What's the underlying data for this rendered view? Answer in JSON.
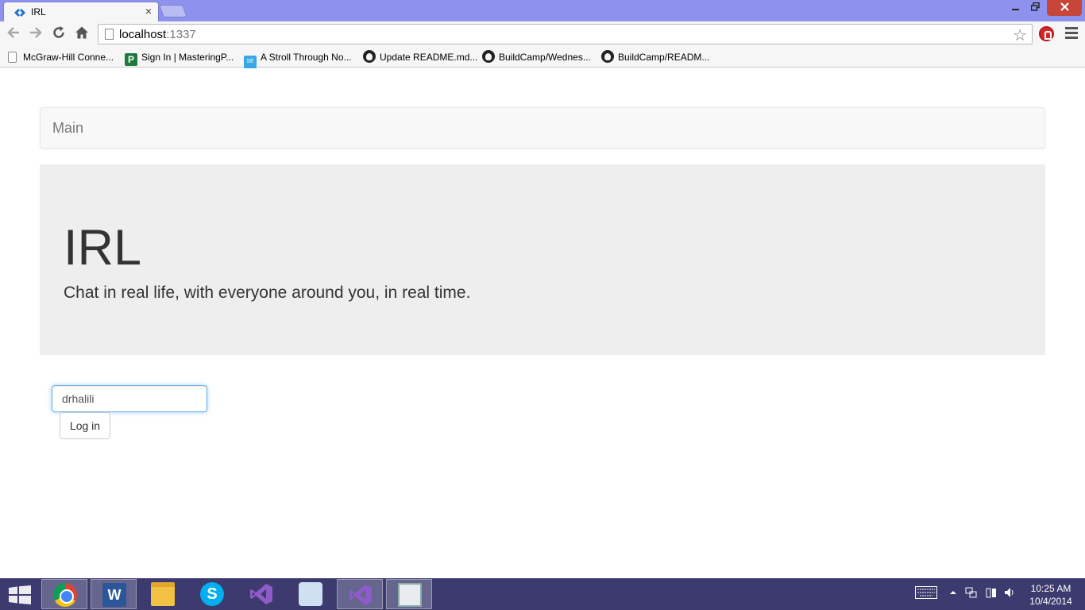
{
  "browser": {
    "tab_title": "IRL",
    "tab_close": "×",
    "address": {
      "host": "localhost",
      "port": ":1337"
    },
    "bookmarks": [
      {
        "label": "McGraw-Hill Conne...",
        "icon": "page-icon"
      },
      {
        "label": "Sign In | MasteringP...",
        "icon": "pearson-icon"
      },
      {
        "label": "A Stroll Through No...",
        "icon": "stackexchange-icon"
      },
      {
        "label": "Update README.md...",
        "icon": "github-icon"
      },
      {
        "label": "BuildCamp/Wednes...",
        "icon": "github-icon"
      },
      {
        "label": "BuildCamp/READM...",
        "icon": "github-icon"
      }
    ]
  },
  "page": {
    "navbar_brand": "Main",
    "jumbotron": {
      "heading": "IRL",
      "lead": "Chat in real life, with everyone around you, in real time."
    },
    "login": {
      "username_value": "drhalili",
      "button_label": "Log in"
    }
  },
  "taskbar": {
    "apps": [
      "chrome",
      "word",
      "file-explorer",
      "skype",
      "visual-studio",
      "pipe-app",
      "visual-studio",
      "news-app"
    ],
    "clock": {
      "time": "10:25 AM",
      "date": "10/4/2014"
    }
  },
  "colors": {
    "titlebar": "#8e92ee",
    "taskbar": "#3c3a6e",
    "jumbotron_bg": "#eeeeee",
    "input_focus": "#66afe9",
    "close_button": "#c7463a"
  }
}
